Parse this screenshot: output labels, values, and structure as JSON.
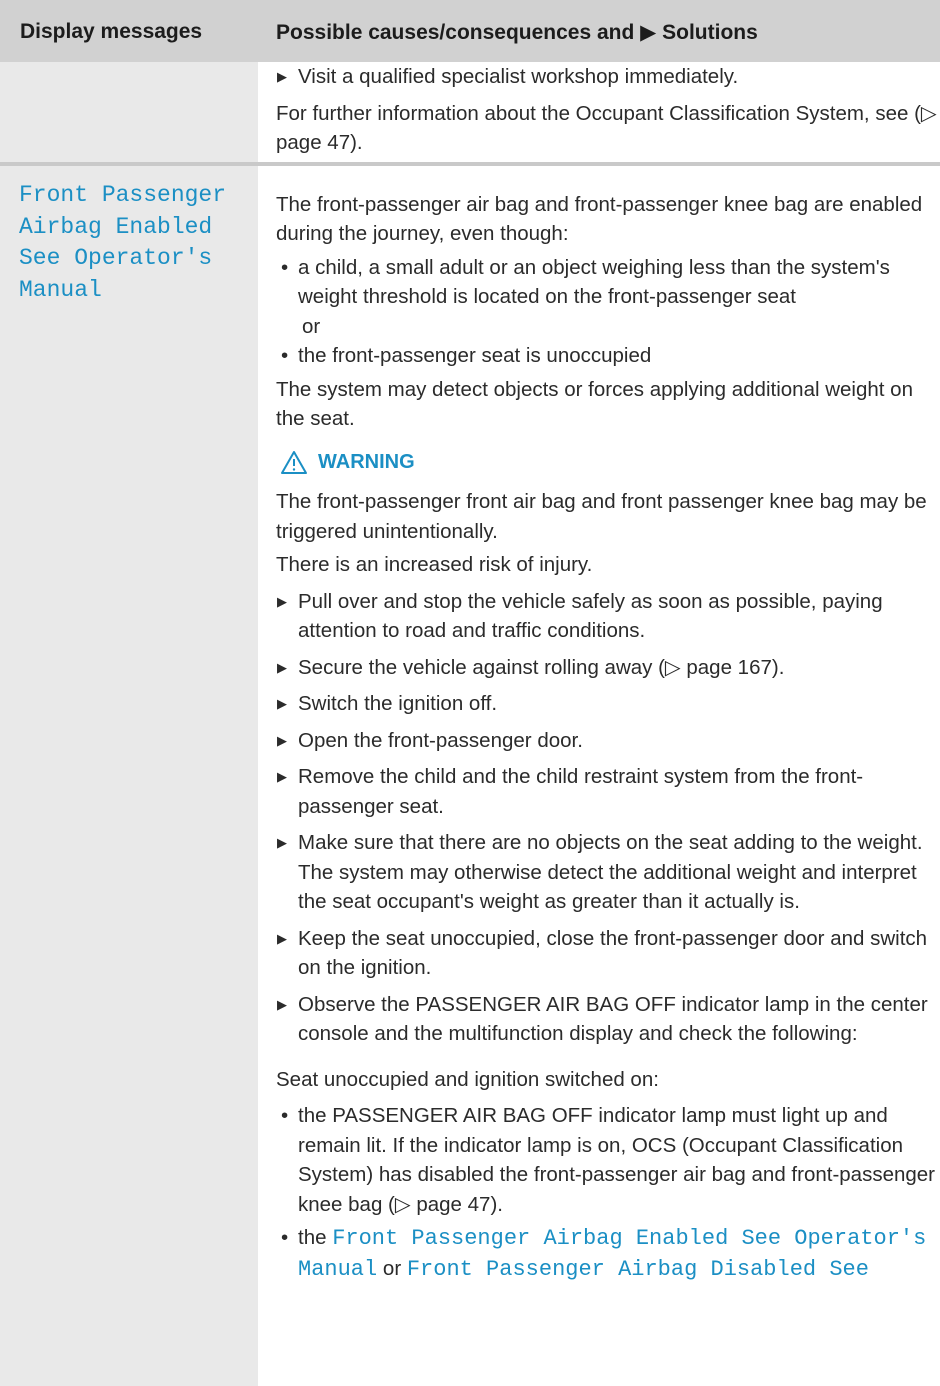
{
  "header": {
    "col1": "Display messages",
    "col2": "Possible causes/consequences and ▶ Solutions"
  },
  "row1": {
    "bullet": "Visit a qualified specialist workshop immediately.",
    "info": "For further information about the Occupant Classification System, see (▷ page 47)."
  },
  "row2": {
    "display_lines": [
      "Front Passenger",
      "Airbag Enabled",
      "See Operator's",
      "Manual"
    ],
    "intro": "The front-passenger air bag and front-passenger knee bag are enabled during the journey, even though:",
    "cond1": "a child, a small adult or an object weighing less than the system's weight threshold is located on the front-passenger seat",
    "or": "or",
    "cond2": "the front-passenger seat is unoccupied",
    "detect": "The system may detect objects or forces applying additional weight on the seat.",
    "warning_label": "WARNING",
    "warn_text": "The front-passenger front air bag and front passenger knee bag may be triggered unintentionally.",
    "risk": "There is an increased risk of injury.",
    "steps": [
      "Pull over and stop the vehicle safely as soon as possible, paying attention to road and traffic conditions.",
      "Secure the vehicle against rolling away (▷ page 167).",
      "Switch the ignition off.",
      "Open the front-passenger door.",
      "Remove the child and the child restraint system from the front-passenger seat.",
      "Make sure that there are no objects on the seat adding to the weight."
    ],
    "step6_note": "The system may otherwise detect the additional weight and interpret the seat occupant's weight as greater than it actually is.",
    "step7": "Keep the seat unoccupied, close the front-passenger door and switch on the ignition.",
    "step8": "Observe the PASSENGER AIR BAG OFF indicator lamp in the center console and the multifunction display and check the following:",
    "seat_state": "Seat unoccupied and ignition switched on:",
    "check1": "the PASSENGER AIR BAG OFF indicator lamp must light up and remain lit. If the indicator lamp is on, OCS (Occupant Classification System) has disabled the front-passenger air bag and front-passenger knee bag (▷ page 47).",
    "check2_pre": "the ",
    "check2_msg1": "Front Passenger Airbag Enabled See Operator's Manual",
    "check2_or": " or ",
    "check2_msg2": "Front Passenger Airbag Disabled See"
  },
  "colors": {
    "accent": "#1b8fc4",
    "header_bg": "#d1d1d1",
    "col_bg": "#e9e9e9"
  },
  "icons": {
    "warning": "warning-triangle-icon"
  }
}
